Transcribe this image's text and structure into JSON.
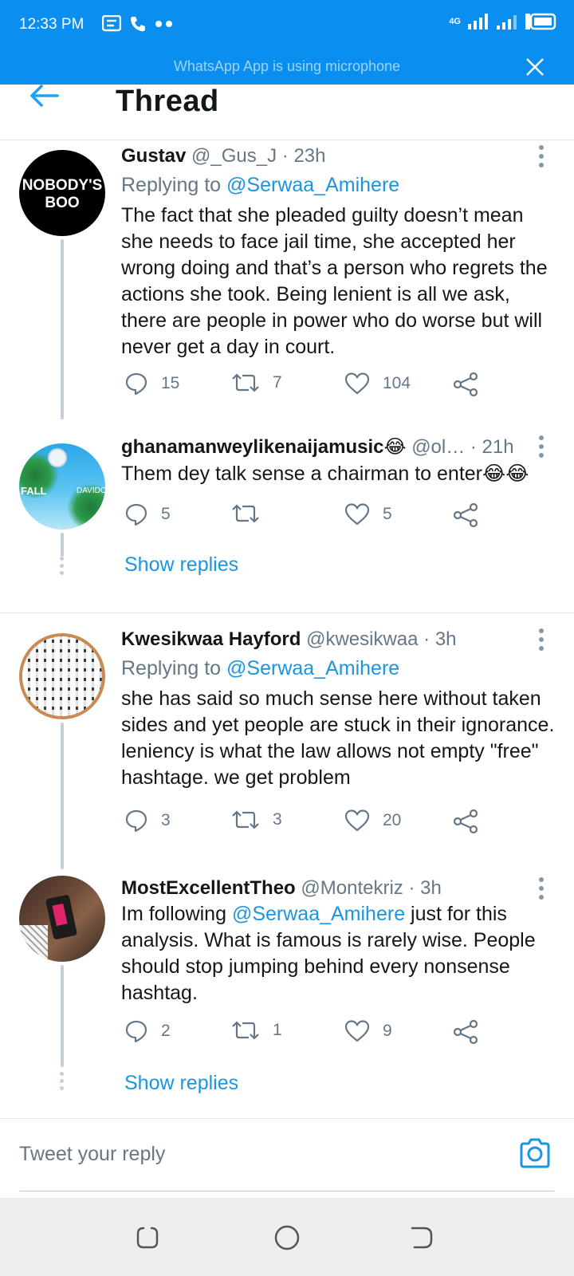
{
  "status": {
    "time": "12:33 PM",
    "network": "4G",
    "banner_text": "WhatsApp App is using microphone"
  },
  "header": {
    "title": "Thread"
  },
  "tweets": [
    {
      "name": "Gustav",
      "meta": "@_Gus_J · 23h",
      "replying_prefix": "Replying to ",
      "replying_to": "@Serwaa_Amihere",
      "text": "The fact that she pleaded guilty doesn’t mean she needs to face jail time, she accepted her wrong doing and that’s a person who regrets the actions she took. Being lenient is all we ask, there are people in power who do worse but will never get a day in court.",
      "avatar_text_1": "NOBODY'S",
      "avatar_text_2": "BOO",
      "replies": "15",
      "retweets": "7",
      "likes": "104"
    },
    {
      "name": "ghanamanweylikenaijamusic😂",
      "meta": "@ol… · 21h",
      "text": "Them dey talk sense a chairman to enter😂😂",
      "avatar_text_1": "FALL",
      "avatar_text_2": "DAVIDO",
      "replies": "5",
      "retweets": "",
      "likes": "5",
      "show_replies": "Show replies"
    },
    {
      "name": "Kwesikwaa Hayford",
      "meta": "@kwesikwaa · 3h",
      "replying_prefix": "Replying to ",
      "replying_to": "@Serwaa_Amihere",
      "text": "she has said so much sense here without taken sides and yet people are stuck in their ignorance. leniency is what the law allows not empty \"free\" hashtage. we get problem",
      "replies": "3",
      "retweets": "3",
      "likes": "20"
    },
    {
      "name": "MostExcellentTheo",
      "meta": "@Montekriz · 3h",
      "text_mention": "@Serwaa_Amihere",
      "text_before": "Im following ",
      "text_after": " just for this analysis. What is famous is rarely wise. People should stop jumping behind every nonsense hashtag.",
      "replies": "2",
      "retweets": "1",
      "likes": "9",
      "show_replies": "Show replies"
    }
  ],
  "reply_bar": {
    "placeholder": "Tweet your reply"
  },
  "colors": {
    "status_bar": "#0a8ff0",
    "accent": "#1b95e0",
    "muted": "#657786"
  }
}
